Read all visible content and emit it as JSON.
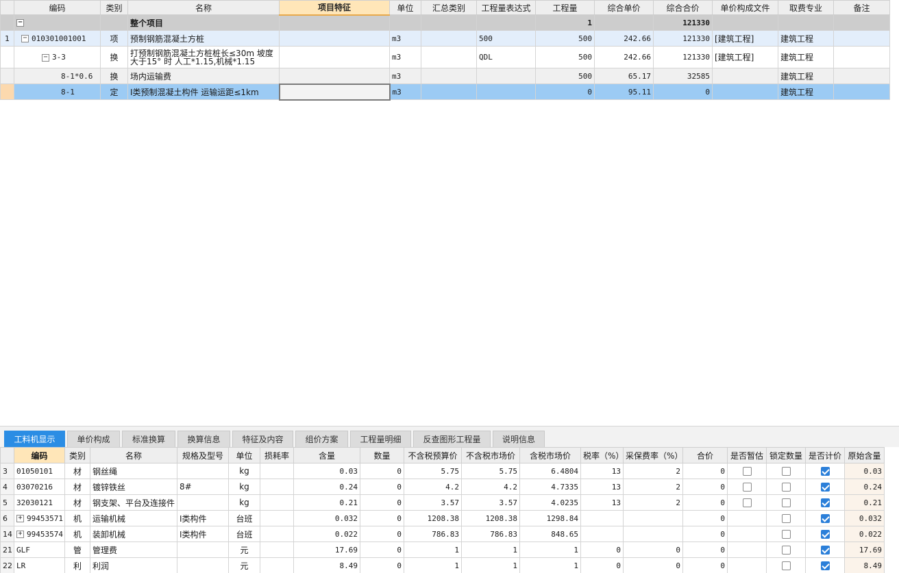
{
  "top_grid": {
    "headers": [
      "",
      "编码",
      "类别",
      "名称",
      "项目特征",
      "单位",
      "汇总类别",
      "工程量表达式",
      "工程量",
      "综合单价",
      "综合合价",
      "单价构成文件",
      "取费专业",
      "备注"
    ],
    "project_row": {
      "toggle": "−",
      "name": "整个项目",
      "quantity": "1",
      "total": "121330"
    },
    "rows": [
      {
        "no": "1",
        "toggle": "−",
        "code": "010301001001",
        "type": "项",
        "name": "预制钢筋混凝土方桩",
        "feature": "",
        "unit": "m3",
        "summary": "",
        "expr": "500",
        "qty": "500",
        "unit_price": "242.66",
        "total": "121330",
        "price_file": "[建筑工程]",
        "specialty": "建筑工程",
        "note": ""
      },
      {
        "no": "",
        "toggle": "−",
        "code": "3-3",
        "type": "换",
        "name": "打预制钢筋混凝土方桩桩长≤30m  坡度大于15° 时 人工*1.15,机械*1.15",
        "feature": "",
        "unit": "m3",
        "summary": "",
        "expr": "QDL",
        "qty": "500",
        "unit_price": "242.66",
        "total": "121330",
        "price_file": "[建筑工程]",
        "specialty": "建筑工程",
        "note": ""
      },
      {
        "no": "",
        "toggle": "",
        "code": "8-1*0.6",
        "type": "换",
        "name": "场内运输费",
        "feature": "",
        "unit": "m3",
        "summary": "",
        "expr": "",
        "qty": "500",
        "unit_price": "65.17",
        "total": "32585",
        "price_file": "",
        "specialty": "建筑工程",
        "note": ""
      },
      {
        "no": "",
        "toggle": "",
        "code": "8-1",
        "type": "定",
        "name": "Ⅰ类预制混凝土构件 运输运距≤1km",
        "feature": "",
        "unit": "m3",
        "summary": "",
        "expr": "",
        "qty": "0",
        "unit_price": "95.11",
        "total": "0",
        "price_file": "",
        "specialty": "建筑工程",
        "note": ""
      }
    ]
  },
  "tabs": [
    "工料机显示",
    "单价构成",
    "标准换算",
    "换算信息",
    "特征及内容",
    "组价方案",
    "工程量明细",
    "反查图形工程量",
    "说明信息"
  ],
  "bottom_grid": {
    "headers": [
      "",
      "编码",
      "类别",
      "名称",
      "规格及型号",
      "单位",
      "损耗率",
      "含量",
      "数量",
      "不含税预算价",
      "不含税市场价",
      "含税市场价",
      "税率（%）",
      "采保费率（%）",
      "合价",
      "是否暂估",
      "锁定数量",
      "是否计价",
      "原始含量"
    ],
    "rows": [
      {
        "no": "3",
        "plus": "",
        "code": "01050101",
        "type": "材",
        "name": "钢丝绳",
        "spec": "",
        "unit": "kg",
        "loss": "",
        "content": "0.03",
        "amount": "0",
        "pre_price": "5.75",
        "market_price": "5.75",
        "tax_market": "6.4804",
        "tax_rate": "13",
        "fee_rate": "2",
        "total": "0",
        "has_est": true,
        "est": false,
        "lock": false,
        "priced": true,
        "orig": "0.03"
      },
      {
        "no": "4",
        "plus": "",
        "code": "03070216",
        "type": "材",
        "name": "镀锌铁丝",
        "spec": "8#",
        "unit": "kg",
        "loss": "",
        "content": "0.24",
        "amount": "0",
        "pre_price": "4.2",
        "market_price": "4.2",
        "tax_market": "4.7335",
        "tax_rate": "13",
        "fee_rate": "2",
        "total": "0",
        "has_est": true,
        "est": false,
        "lock": false,
        "priced": true,
        "orig": "0.24"
      },
      {
        "no": "5",
        "plus": "",
        "code": "32030121",
        "type": "材",
        "name": "钢支架、平台及连接件",
        "spec": "",
        "unit": "kg",
        "loss": "",
        "content": "0.21",
        "amount": "0",
        "pre_price": "3.57",
        "market_price": "3.57",
        "tax_market": "4.0235",
        "tax_rate": "13",
        "fee_rate": "2",
        "total": "0",
        "has_est": true,
        "est": false,
        "lock": false,
        "priced": true,
        "orig": "0.21"
      },
      {
        "no": "6",
        "plus": "+",
        "code": "99453571",
        "type": "机",
        "name": "运输机械",
        "spec": "Ⅰ类构件",
        "unit": "台班",
        "loss": "",
        "content": "0.032",
        "amount": "0",
        "pre_price": "1208.38",
        "market_price": "1208.38",
        "tax_market": "1298.84",
        "tax_rate": "",
        "fee_rate": "",
        "total": "0",
        "has_est": false,
        "est": false,
        "lock": false,
        "priced": true,
        "orig": "0.032"
      },
      {
        "no": "14",
        "plus": "+",
        "code": "99453574",
        "type": "机",
        "name": "装卸机械",
        "spec": "Ⅰ类构件",
        "unit": "台班",
        "loss": "",
        "content": "0.022",
        "amount": "0",
        "pre_price": "786.83",
        "market_price": "786.83",
        "tax_market": "848.65",
        "tax_rate": "",
        "fee_rate": "",
        "total": "0",
        "has_est": false,
        "est": false,
        "lock": false,
        "priced": true,
        "orig": "0.022"
      },
      {
        "no": "21",
        "plus": "",
        "code": "GLF",
        "type": "管",
        "name": "管理费",
        "spec": "",
        "unit": "元",
        "loss": "",
        "content": "17.69",
        "amount": "0",
        "pre_price": "1",
        "market_price": "1",
        "tax_market": "1",
        "tax_rate": "0",
        "fee_rate": "0",
        "total": "0",
        "has_est": false,
        "est": false,
        "lock": false,
        "priced": true,
        "orig": "17.69"
      },
      {
        "no": "22",
        "plus": "",
        "code": "LR",
        "type": "利",
        "name": "利润",
        "spec": "",
        "unit": "元",
        "loss": "",
        "content": "8.49",
        "amount": "0",
        "pre_price": "1",
        "market_price": "1",
        "tax_market": "1",
        "tax_rate": "0",
        "fee_rate": "0",
        "total": "0",
        "has_est": false,
        "est": false,
        "lock": false,
        "priced": true,
        "orig": "8.49"
      }
    ]
  },
  "colors": {
    "accent": "#2b8de4",
    "selected_row": "#9ccbf4",
    "header_highlight": "#ffe6b8"
  }
}
